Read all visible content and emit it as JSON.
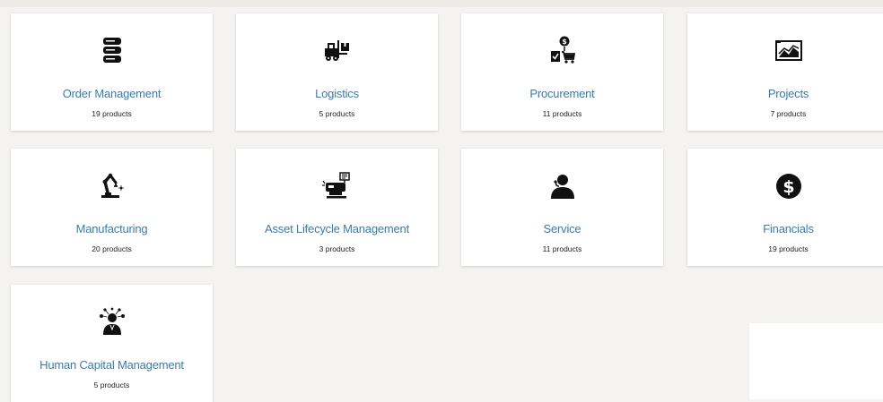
{
  "cards": [
    {
      "title": "Order Management",
      "count": "19 products",
      "icon": "database-icon"
    },
    {
      "title": "Logistics",
      "count": "5 products",
      "icon": "forklift-icon"
    },
    {
      "title": "Procurement",
      "count": "11 products",
      "icon": "procurement-cart-icon"
    },
    {
      "title": "Projects",
      "count": "7 products",
      "icon": "projects-chart-icon"
    },
    {
      "title": "Manufacturing",
      "count": "20 products",
      "icon": "robot-arm-icon"
    },
    {
      "title": "Asset Lifecycle Management",
      "count": "3 products",
      "icon": "asset-machine-icon"
    },
    {
      "title": "Service",
      "count": "11 products",
      "icon": "service-agent-icon"
    },
    {
      "title": "Financials",
      "count": "19 products",
      "icon": "dollar-circle-icon"
    },
    {
      "title": "Human Capital Management",
      "count": "5 products",
      "icon": "people-network-icon"
    }
  ],
  "colors": {
    "background": "#f4f3f1",
    "card": "#ffffff",
    "title": "#3a7bab",
    "count": "#222222",
    "icon": "#111111"
  }
}
